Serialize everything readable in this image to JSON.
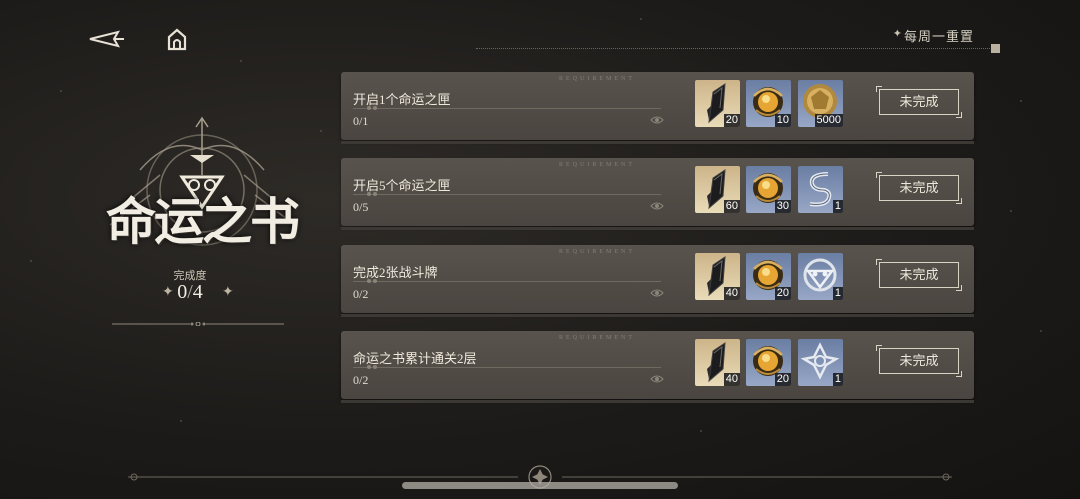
{
  "header": {
    "back_icon": "back-arrow-icon",
    "home_icon": "home-icon",
    "reset_label": "每周一重置"
  },
  "book": {
    "title": "命运之书",
    "progress_label": "完成度",
    "progress_done": "0",
    "progress_total": "4"
  },
  "requirement_label": "REQUIREMENT",
  "quests": [
    {
      "title": "开启1个命运之匣",
      "progress": "0/1",
      "status": "未完成",
      "rewards": [
        {
          "icon": "black-feather-crystal-icon",
          "count": "20",
          "rarity": "gold"
        },
        {
          "icon": "golden-orb-icon",
          "count": "10",
          "rarity": "blue"
        },
        {
          "icon": "gold-coin-icon",
          "count": "5000",
          "rarity": "blue"
        }
      ]
    },
    {
      "title": "开启5个命运之匣",
      "progress": "0/5",
      "status": "未完成",
      "rewards": [
        {
          "icon": "black-feather-crystal-icon",
          "count": "60",
          "rarity": "gold"
        },
        {
          "icon": "golden-orb-icon",
          "count": "30",
          "rarity": "blue"
        },
        {
          "icon": "silver-serpent-emblem-icon",
          "count": "1",
          "rarity": "blue"
        }
      ]
    },
    {
      "title": "完成2张战斗牌",
      "progress": "0/2",
      "status": "未完成",
      "rewards": [
        {
          "icon": "black-feather-crystal-icon",
          "count": "40",
          "rarity": "gold"
        },
        {
          "icon": "golden-orb-icon",
          "count": "20",
          "rarity": "blue"
        },
        {
          "icon": "silver-mask-emblem-icon",
          "count": "1",
          "rarity": "blue"
        }
      ]
    },
    {
      "title": "命运之书累计通关2层",
      "progress": "0/2",
      "status": "未完成",
      "rewards": [
        {
          "icon": "black-feather-crystal-icon",
          "count": "40",
          "rarity": "gold"
        },
        {
          "icon": "golden-orb-icon",
          "count": "20",
          "rarity": "blue"
        },
        {
          "icon": "silver-knot-emblem-icon",
          "count": "1",
          "rarity": "blue"
        }
      ]
    }
  ],
  "colors": {
    "background": "#1d1b19",
    "card": "#524d47",
    "gold_rarity": "#d9c59a",
    "blue_rarity": "#7d8fb3"
  }
}
